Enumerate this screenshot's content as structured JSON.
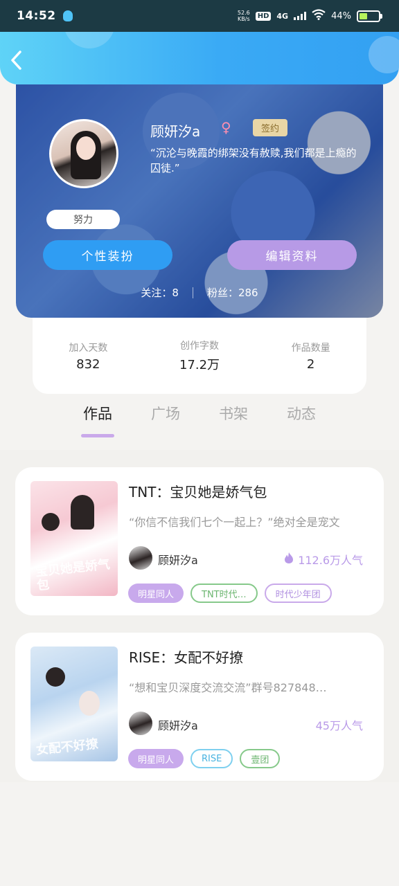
{
  "status_bar": {
    "time": "14:52",
    "net_speed": "52.6",
    "net_unit": "KB/s",
    "hd": "HD",
    "network": "4G",
    "battery_text": "44%",
    "battery_level": 0.44
  },
  "header": {},
  "profile": {
    "username": "顾妍汐a",
    "gender_symbol": "♀",
    "signed_tag": "签约",
    "bio": "“沉沦与晚霞的绑架没有赦赎,我们都是上瘾的囚徒.”",
    "badge": "努力",
    "btn_style": "个性装扮",
    "btn_edit": "编辑资料",
    "following_label": "关注：8",
    "followers_label": "粉丝：286"
  },
  "stats": [
    {
      "label": "加入天数",
      "value": "832"
    },
    {
      "label": "创作字数",
      "value": "17.2万"
    },
    {
      "label": "作品数量",
      "value": "2"
    }
  ],
  "tabs": [
    {
      "label": "作品",
      "active": true
    },
    {
      "label": "广场",
      "active": false
    },
    {
      "label": "书架",
      "active": false
    },
    {
      "label": "动态",
      "active": false
    }
  ],
  "works": [
    {
      "title": "TNT：宝贝她是娇气包",
      "desc": "“你信不信我们七个一起上？”绝对全是宠文",
      "cover_text": "宝贝她是娇气包",
      "author": "顾妍汐a",
      "popularity": "112.6万人气",
      "tags": [
        "明星同人",
        "TNT时代…",
        "时代少年团"
      ]
    },
    {
      "title": "RISE：女配不好撩",
      "desc": "“想和宝贝深度交流交流”群号827848…",
      "cover_text": "女配不好撩",
      "author": "顾妍汐a",
      "popularity": "45万人气",
      "tags": [
        "明星同人",
        "RISE",
        "壹团"
      ]
    }
  ],
  "colors": {
    "accent_blue": "#2f9df3",
    "accent_purple": "#b79ae6"
  }
}
